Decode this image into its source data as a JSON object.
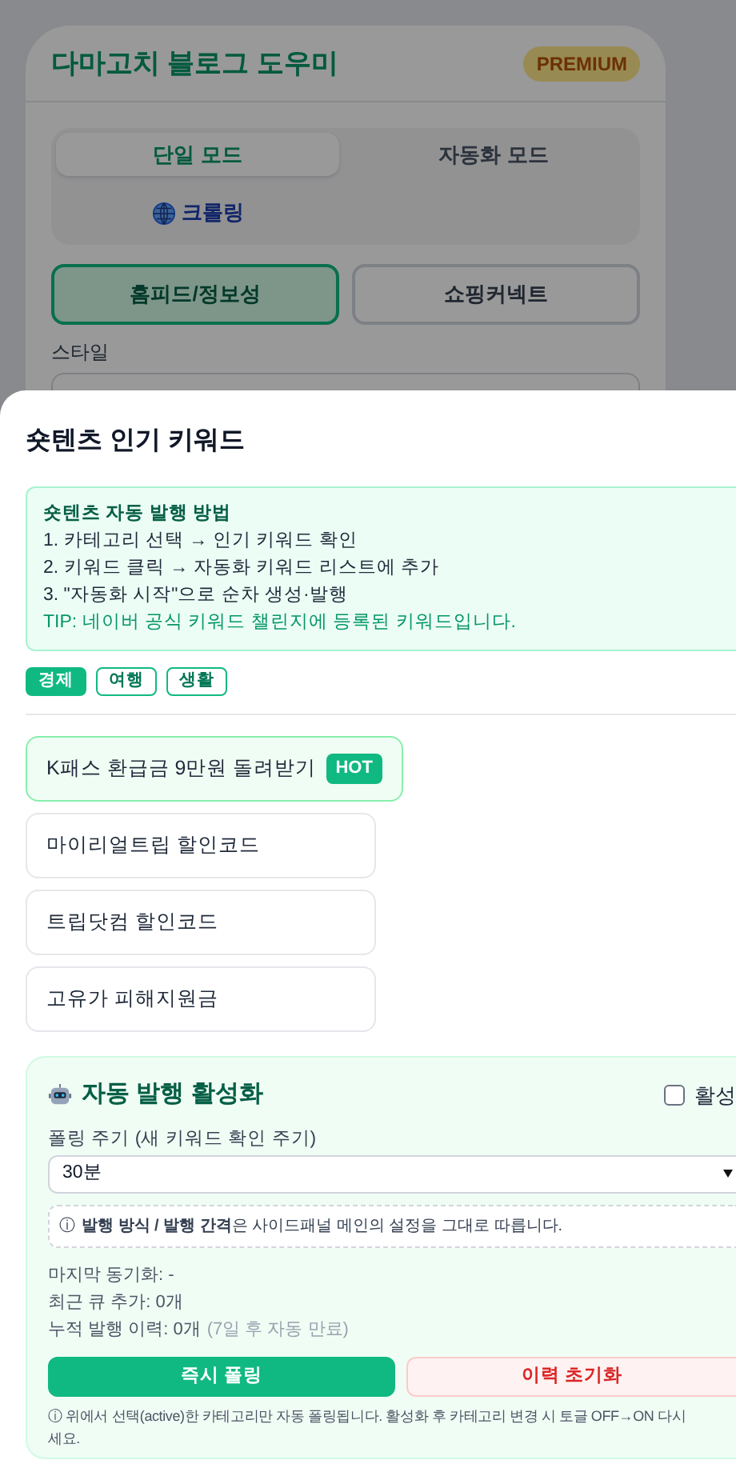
{
  "app": {
    "title": "다마고치 블로그 도우미",
    "badge": "PREMIUM",
    "mode_tabs": [
      {
        "label": "단일 모드",
        "selected": true,
        "kind": "text"
      },
      {
        "label": "자동화 모드",
        "selected": false,
        "kind": "text"
      },
      {
        "label": "크롤링",
        "selected": false,
        "kind": "globe"
      }
    ],
    "type_buttons": [
      {
        "label": "홈피드/정보성",
        "selected": true
      },
      {
        "label": "쇼핑커넥트",
        "selected": false
      }
    ],
    "style_label": "스타일"
  },
  "sheet": {
    "title": "숏텐츠 인기 키워드",
    "guide": {
      "heading": "숏텐츠 자동 발행 방법",
      "steps": [
        "1. 카테고리 선택 → 인기 키워드 확인",
        "2. 키워드 클릭 → 자동화 키워드 리스트에 추가",
        "3. \"자동화 시작\"으로 순차 생성·발행"
      ],
      "tip": "TIP: 네이버 공식 키워드 챌린지에 등록된 키워드입니다."
    },
    "categories": [
      {
        "label": "경제",
        "selected": true
      },
      {
        "label": "여행",
        "selected": false
      },
      {
        "label": "생활",
        "selected": false
      }
    ],
    "keywords": [
      {
        "label": "K패스 환급금 9만원 돌려받기",
        "badge": "HOT",
        "highlighted": true
      },
      {
        "label": "마이리얼트립 할인코드",
        "highlighted": false
      },
      {
        "label": "트립닷컴 할인코드",
        "highlighted": false
      },
      {
        "label": "고유가 피해지원금",
        "highlighted": false
      }
    ],
    "auto": {
      "title": "자동 발행 활성화",
      "toggle": {
        "label": "활성",
        "checked": false
      },
      "interval_label": "폴링 주기 (새 키워드 확인 주기)",
      "interval_value": "30분",
      "notice_icon": "ⓘ",
      "notice": "**발행 방식 / 발행 간격**은 사이드패널 메인의 설정을 그대로 따릅니다.",
      "last_sync": "마지막 동기화: -",
      "recent_queue": "최근 큐 추가: 0개",
      "history": "누적 발행 이력: 0개",
      "history_note": "(7일 후 자동 만료)",
      "buttons": [
        {
          "label": "즉시 폴링",
          "kind": "primary"
        },
        {
          "label": "이력 초기화",
          "kind": "danger"
        }
      ],
      "footnote": [
        "ⓘ 위에서 선택(active)한 카테고리만 자동 폴링됩니다. 활성화 후 카테고리 변경 시 토글 OFF→ON 다시",
        "세요."
      ]
    }
  }
}
